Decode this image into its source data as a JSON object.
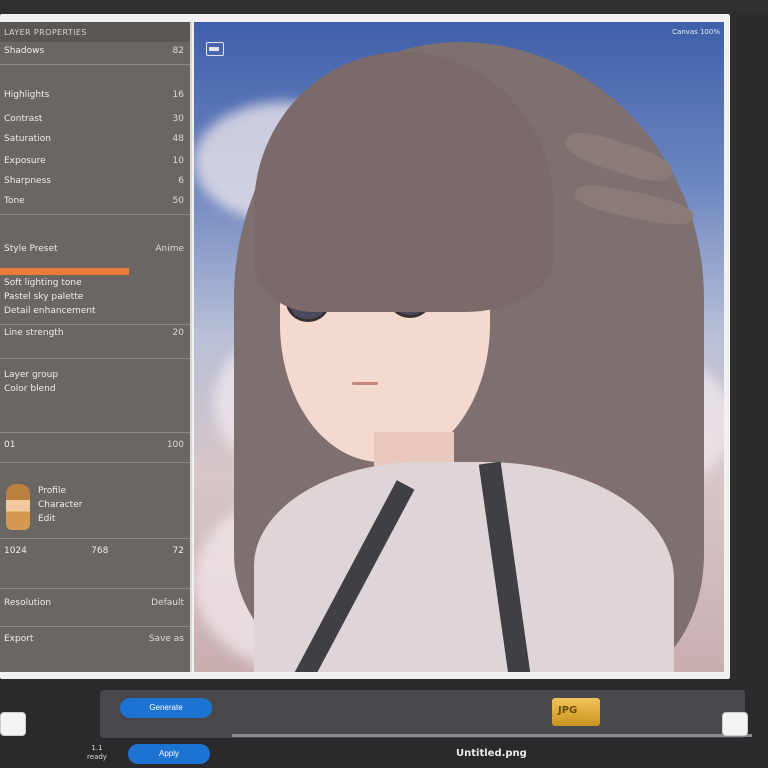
{
  "panel": {
    "header": "LAYER PROPERTIES",
    "rows": [
      {
        "label": "Shadows",
        "value": "82"
      },
      {
        "label": "Highlights",
        "value": "16"
      },
      {
        "label": "Contrast",
        "value": "30"
      },
      {
        "label": "Saturation",
        "value": "48"
      },
      {
        "label": "Exposure",
        "value": "10"
      },
      {
        "label": "Sharpness",
        "value": "6"
      },
      {
        "label": "Tone",
        "value": "50"
      }
    ],
    "section2_title": "Style Preset",
    "section2_value": "Anime",
    "section3_lines": [
      "Soft lighting tone",
      "Pastel sky palette",
      "Detail enhancement"
    ],
    "section4_label": "Line strength",
    "section4_value": "20",
    "section5_lines": [
      "Layer group",
      "Color blend"
    ],
    "section6_label": "01",
    "section6_value": "100",
    "profile_title": "Profile",
    "profile_sub": "Character",
    "profile_meta": "Edit",
    "metrics": [
      "1024",
      "768",
      "72"
    ],
    "footer_label": "Resolution",
    "footer_value": "Default",
    "bottom_left": "Export",
    "bottom_right": "Save as"
  },
  "canvas": {
    "title": "Canvas 100%"
  },
  "toolbar": {
    "primary_button": "Generate",
    "secondary_button": "Apply",
    "status_top": "1.1",
    "status_bottom": "ready",
    "file_label": "Untitled.png",
    "thumb_label": "JPG"
  },
  "colors": {
    "accent": "#1c73d2",
    "slider": "#e87a3a",
    "panel_bg": "#6a6664"
  },
  "progress": {
    "slider_fraction": 0.68
  }
}
